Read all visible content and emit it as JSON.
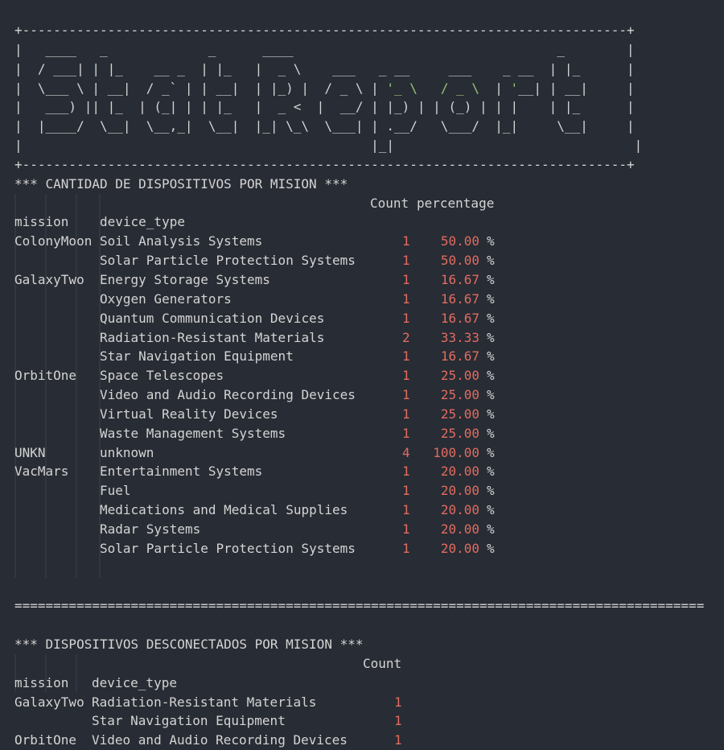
{
  "banner": {
    "top_border": "+------------------------------------------------------------------------------+",
    "bottom_border": "+------------------------------------------------------------------------------+",
    "art": [
      "|   ____   _             _      ____                                  _        |",
      "|  / ___| | |_    __ _  | |_   |  _ \\    ___   _ __     ___    _ __  | |_      |",
      "|  \\___ \\ | __|  / _` | | __|  | |_) |  / _ \\ | '_ \\   / _ \\  | '__| | __|     |",
      "|   ___) || |_  | (_| | | |_   |  _ <  |  __/ | |_) | | (_) | | |    | |_      |",
      "|  |____/  \\__|  \\__,_|  \\__|  |_| \\_\\  \\___| | .__/   \\___/  |_|     \\__|     |",
      "|                                             |_|                               |"
    ]
  },
  "section1": {
    "title": "*** CANTIDAD DE DISPOSITIVOS POR MISION ***",
    "col_count": "Count",
    "col_percentage": "percentage",
    "col_mission": "mission",
    "col_device_type": "device_type",
    "rows": [
      {
        "mission": "ColonyMoon",
        "device": "Soil Analysis Systems",
        "count": "1",
        "pct": "50.00",
        "unit": "%"
      },
      {
        "mission": "",
        "device": "Solar Particle Protection Systems",
        "count": "1",
        "pct": "50.00",
        "unit": "%"
      },
      {
        "mission": "GalaxyTwo",
        "device": "Energy Storage Systems",
        "count": "1",
        "pct": "16.67",
        "unit": "%"
      },
      {
        "mission": "",
        "device": "Oxygen Generators",
        "count": "1",
        "pct": "16.67",
        "unit": "%"
      },
      {
        "mission": "",
        "device": "Quantum Communication Devices",
        "count": "1",
        "pct": "16.67",
        "unit": "%"
      },
      {
        "mission": "",
        "device": "Radiation-Resistant Materials",
        "count": "2",
        "pct": "33.33",
        "unit": "%"
      },
      {
        "mission": "",
        "device": "Star Navigation Equipment",
        "count": "1",
        "pct": "16.67",
        "unit": "%"
      },
      {
        "mission": "OrbitOne",
        "device": "Space Telescopes",
        "count": "1",
        "pct": "25.00",
        "unit": "%"
      },
      {
        "mission": "",
        "device": "Video and Audio Recording Devices",
        "count": "1",
        "pct": "25.00",
        "unit": "%"
      },
      {
        "mission": "",
        "device": "Virtual Reality Devices",
        "count": "1",
        "pct": "25.00",
        "unit": "%"
      },
      {
        "mission": "",
        "device": "Waste Management Systems",
        "count": "1",
        "pct": "25.00",
        "unit": "%"
      },
      {
        "mission": "UNKN",
        "device": "unknown",
        "count": "4",
        "pct": "100.00",
        "unit": "%"
      },
      {
        "mission": "VacMars",
        "device": "Entertainment Systems",
        "count": "1",
        "pct": "20.00",
        "unit": "%"
      },
      {
        "mission": "",
        "device": "Fuel",
        "count": "1",
        "pct": "20.00",
        "unit": "%"
      },
      {
        "mission": "",
        "device": "Medications and Medical Supplies",
        "count": "1",
        "pct": "20.00",
        "unit": "%"
      },
      {
        "mission": "",
        "device": "Radar Systems",
        "count": "1",
        "pct": "20.00",
        "unit": "%"
      },
      {
        "mission": "",
        "device": "Solar Particle Protection Systems",
        "count": "1",
        "pct": "20.00",
        "unit": "%"
      }
    ]
  },
  "separator": "=========================================================================================",
  "section2": {
    "title": "*** DISPOSITIVOS DESCONECTADOS POR MISION ***",
    "col_count": "Count",
    "col_mission": "mission",
    "col_device_type": "device_type",
    "rows": [
      {
        "mission": "GalaxyTwo",
        "device": "Radiation-Resistant Materials",
        "count": "1"
      },
      {
        "mission": "",
        "device": "Star Navigation Equipment",
        "count": "1"
      },
      {
        "mission": "OrbitOne",
        "device": "Video and Audio Recording Devices",
        "count": "1"
      }
    ]
  },
  "colors": {
    "background": "#282c34",
    "text": "#d4d4d4",
    "number": "#e06c60",
    "art_accent": "#98c379",
    "guide": "#3b4048"
  }
}
